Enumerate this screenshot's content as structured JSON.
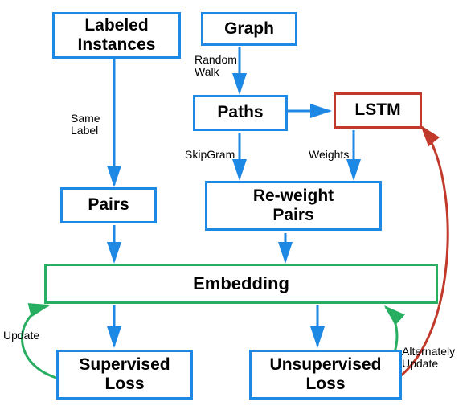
{
  "nodes": {
    "labeled_instances": "Labeled\nInstances",
    "graph": "Graph",
    "paths": "Paths",
    "lstm": "LSTM",
    "pairs": "Pairs",
    "reweight_pairs": "Re-weight\nPairs",
    "embedding": "Embedding",
    "supervised_loss": "Supervised\nLoss",
    "unsupervised_loss": "Unsupervised\nLoss"
  },
  "edge_labels": {
    "same_label": "Same\nLabel",
    "random_walk": "Random\nWalk",
    "skipgram": "SkipGram",
    "weights": "Weights",
    "update": "Update",
    "alt_update": "Alternately\nUpdate"
  },
  "colors": {
    "blue": "#1e88e5",
    "red": "#c0392b",
    "green": "#27ae60"
  }
}
